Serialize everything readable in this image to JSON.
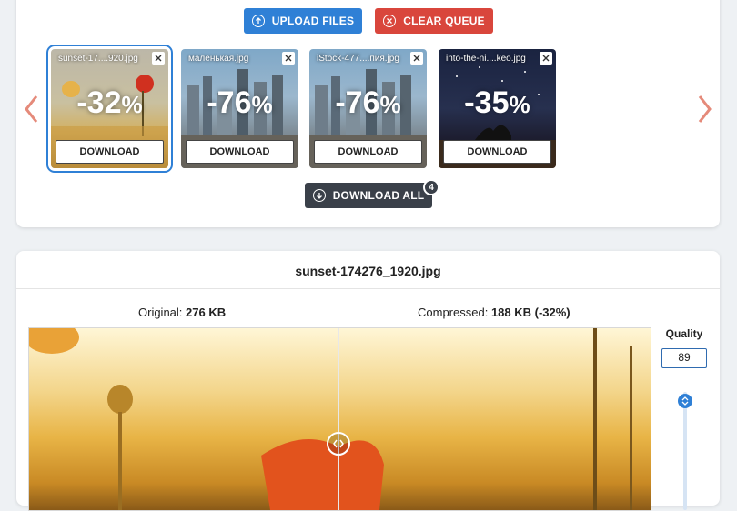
{
  "toolbar": {
    "upload_label": "UPLOAD FILES",
    "clear_label": "CLEAR QUEUE",
    "download_all_label": "DOWNLOAD ALL",
    "download_all_count": "4"
  },
  "queue": [
    {
      "name": "sunset-17....920.jpg",
      "reduction": "-32",
      "download": "DOWNLOAD"
    },
    {
      "name": "маленькая.jpg",
      "reduction": "-76",
      "download": "DOWNLOAD"
    },
    {
      "name": "iStock-477....пия.jpg",
      "reduction": "-76",
      "download": "DOWNLOAD"
    },
    {
      "name": "into-the-ni....keo.jpg",
      "reduction": "-35",
      "download": "DOWNLOAD"
    }
  ],
  "percent_sign": "%",
  "details": {
    "filename": "sunset-174276_1920.jpg",
    "original_label": "Original:",
    "original_size": "276 KB",
    "compressed_label": "Compressed:",
    "compressed_size": "188 KB (-32%)",
    "quality_label": "Quality",
    "quality_value": "89"
  },
  "colors": {
    "primary": "#2f80d6",
    "danger": "#d9463c",
    "dark": "#3a4049",
    "arrow": "#e58a7a"
  },
  "icons": {
    "upload": "arrow-up-circle-icon",
    "clear": "x-circle-icon",
    "download_all": "arrow-down-circle-icon",
    "prev": "chevron-left-icon",
    "next": "chevron-right-icon",
    "close": "close-icon",
    "handle": "split-handle-icon",
    "knob": "chevron-up-down-icon"
  }
}
